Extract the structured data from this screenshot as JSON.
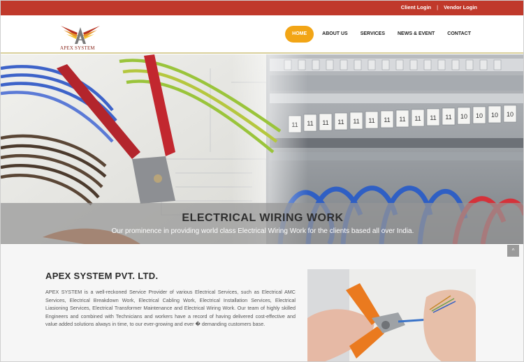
{
  "topbar": {
    "client_login": "Client Login",
    "separator": "|",
    "vendor_login": "Vendor Login"
  },
  "logo": {
    "text": "APEX SYSTEM"
  },
  "nav": {
    "items": [
      {
        "label": "HOME",
        "active": true
      },
      {
        "label": "ABOUT US"
      },
      {
        "label": "SERVICES"
      },
      {
        "label": "NEWS & EVENT"
      },
      {
        "label": "CONTACT"
      }
    ]
  },
  "hero": {
    "title": "ELECTRICAL WIRING WORK",
    "subtitle": "Our prominence in providing world class Electrical Wiring Work for the clients based all over India.",
    "terminal_labels": [
      "11",
      "11",
      "11",
      "11",
      "11",
      "11",
      "11",
      "11",
      "11",
      "11",
      "11",
      "10",
      "10",
      "10",
      "10"
    ]
  },
  "scroll_top": {
    "icon": "chevron-up-icon",
    "glyph": "^"
  },
  "about": {
    "title": "APEX SYSTEM PVT. LTD.",
    "body": "APEX SYSTEM is a well-reckoned Service Provider of various Electrical Services, such as Electrical AMC Services, Electrical Breakdown Work, Electrical Cabling Work, Electrical Installation Services, Electrical Liasioning Services, Electrical Transformer Maintenance and Electrical Wiring Work. Our team of highly skilled Engineers and combined with Technicians and workers have a record of having delivered cost-effective and value added solutions always in time, to our ever-growing and ever � demanding customers base."
  },
  "colors": {
    "topbar": "#c0392b",
    "nav_active": "#f2a516",
    "logo_red": "#b8321f",
    "logo_orange": "#e8962a"
  }
}
